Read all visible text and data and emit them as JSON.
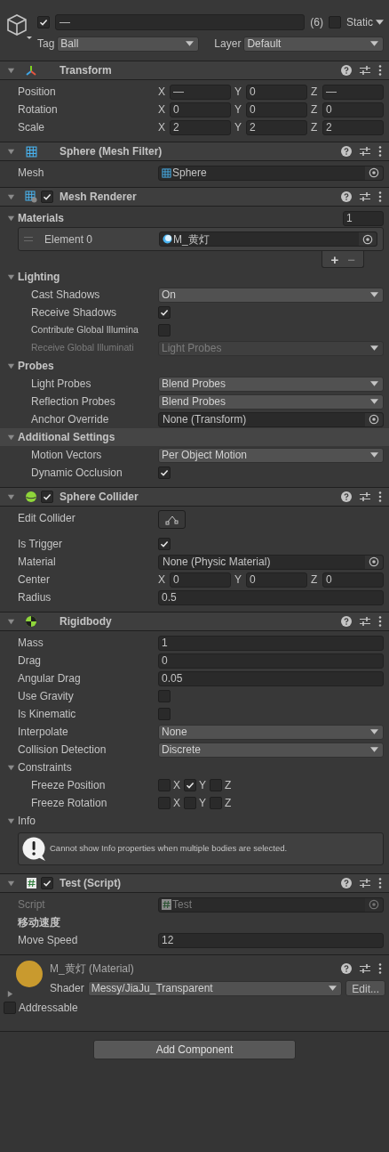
{
  "object": {
    "active": true,
    "name": "—",
    "count": "(6)",
    "static": false,
    "static_label": "Static",
    "tag_label": "Tag",
    "tag": "Ball",
    "layer_label": "Layer",
    "layer": "Default"
  },
  "components": [
    {
      "kind": "transform",
      "title": "Transform",
      "expanded": true,
      "rows": [
        {
          "kind": "vector3",
          "label": "Position",
          "axes": [
            {
              "axis": "X",
              "value": "—"
            },
            {
              "axis": "Y",
              "value": "0"
            },
            {
              "axis": "Z",
              "value": "—"
            }
          ]
        },
        {
          "kind": "vector3",
          "label": "Rotation",
          "axes": [
            {
              "axis": "X",
              "value": "0"
            },
            {
              "axis": "Y",
              "value": "0"
            },
            {
              "axis": "Z",
              "value": "0"
            }
          ]
        },
        {
          "kind": "vector3",
          "label": "Scale",
          "axes": [
            {
              "axis": "X",
              "value": "2"
            },
            {
              "axis": "Y",
              "value": "2"
            },
            {
              "axis": "Z",
              "value": "2"
            }
          ]
        }
      ]
    },
    {
      "kind": "mesh",
      "title": "Sphere (Mesh Filter)",
      "expanded": true,
      "rows": [
        {
          "kind": "object",
          "label": "Mesh",
          "value": "Sphere"
        }
      ]
    },
    {
      "kind": "renderer",
      "title": "Mesh Renderer",
      "enabled": true,
      "expanded": true,
      "rows": [
        {
          "kind": "foldout",
          "label": "Materials",
          "expanded": true,
          "count": "1"
        },
        {
          "kind": "list",
          "elements": [
            {
              "label": "Element 0",
              "value": "M_黄灯"
            }
          ],
          "add": "+",
          "remove": "−"
        },
        {
          "kind": "foldout",
          "label": "Lighting",
          "expanded": true
        },
        {
          "kind": "dropdown",
          "label": "Cast Shadows",
          "value": "On",
          "indent": true
        },
        {
          "kind": "checkbox",
          "label": "Receive Shadows",
          "checked": true,
          "indent": true
        },
        {
          "kind": "checkbox",
          "label": "Contribute Global Illumina",
          "checked": false,
          "indent": true
        },
        {
          "kind": "dropdown",
          "label": "Receive Global Illuminati",
          "value": "Light Probes",
          "indent": true,
          "disabled": true
        },
        {
          "kind": "foldout",
          "label": "Probes",
          "expanded": true
        },
        {
          "kind": "dropdown",
          "label": "Light Probes",
          "value": "Blend Probes",
          "indent": true
        },
        {
          "kind": "dropdown",
          "label": "Reflection Probes",
          "value": "Blend Probes",
          "indent": true
        },
        {
          "kind": "object",
          "label": "Anchor Override",
          "value": "None (Transform)",
          "indent": true
        },
        {
          "kind": "foldout",
          "label": "Additional Settings",
          "expanded": true,
          "selected": true
        },
        {
          "kind": "dropdown",
          "label": "Motion Vectors",
          "value": "Per Object Motion",
          "indent": true
        },
        {
          "kind": "checkbox",
          "label": "Dynamic Occlusion",
          "checked": true,
          "indent": true
        }
      ]
    },
    {
      "kind": "sphere_collider",
      "title": "Sphere Collider",
      "enabled": true,
      "expanded": true,
      "rows": [
        {
          "kind": "edit_collider",
          "label": "Edit Collider"
        },
        {
          "kind": "checkbox",
          "label": "Is Trigger",
          "checked": true
        },
        {
          "kind": "object",
          "label": "Material",
          "value": "None (Physic Material)"
        },
        {
          "kind": "vector3",
          "label": "Center",
          "axes": [
            {
              "axis": "X",
              "value": "0"
            },
            {
              "axis": "Y",
              "value": "0"
            },
            {
              "axis": "Z",
              "value": "0"
            }
          ]
        },
        {
          "kind": "field",
          "label": "Radius",
          "value": "0.5"
        }
      ]
    },
    {
      "kind": "rigidbody",
      "title": "Rigidbody",
      "expanded": true,
      "rows": [
        {
          "kind": "field",
          "label": "Mass",
          "value": "1"
        },
        {
          "kind": "field",
          "label": "Drag",
          "value": "0"
        },
        {
          "kind": "field",
          "label": "Angular Drag",
          "value": "0.05"
        },
        {
          "kind": "checkbox",
          "label": "Use Gravity",
          "checked": false
        },
        {
          "kind": "checkbox",
          "label": "Is Kinematic",
          "checked": false
        },
        {
          "kind": "dropdown",
          "label": "Interpolate",
          "value": "None"
        },
        {
          "kind": "dropdown",
          "label": "Collision Detection",
          "value": "Discrete"
        },
        {
          "kind": "foldout",
          "label": "Constraints",
          "expanded": true,
          "plain": true
        },
        {
          "kind": "axis_toggles",
          "label": "Freeze Position",
          "indent": true,
          "axes": [
            {
              "axis": "X",
              "checked": false
            },
            {
              "axis": "Y",
              "checked": true
            },
            {
              "axis": "Z",
              "checked": false
            }
          ]
        },
        {
          "kind": "axis_toggles",
          "label": "Freeze Rotation",
          "indent": true,
          "axes": [
            {
              "axis": "X",
              "checked": false
            },
            {
              "axis": "Y",
              "checked": false
            },
            {
              "axis": "Z",
              "checked": false
            }
          ]
        },
        {
          "kind": "foldout",
          "label": "Info",
          "expanded": true,
          "plain": true
        },
        {
          "kind": "help",
          "text": "Cannot show Info properties when multiple bodies are selected."
        }
      ]
    },
    {
      "kind": "script",
      "title": "Test (Script)",
      "enabled": true,
      "expanded": true,
      "rows": [
        {
          "kind": "object",
          "label": "Script",
          "value": "Test",
          "disabled": true
        },
        {
          "kind": "heading",
          "label": "移动速度"
        },
        {
          "kind": "field",
          "label": "Move Speed",
          "value": "12"
        }
      ]
    }
  ],
  "material": {
    "title": "M_黄灯 (Material)",
    "expanded": false,
    "shader_label": "Shader",
    "shader": "Messy/JiaJu_Transparent",
    "edit": "Edit...",
    "color": "#c99a2e"
  },
  "addressable": {
    "label": "Addressable",
    "checked": false
  },
  "add_component": "Add Component"
}
